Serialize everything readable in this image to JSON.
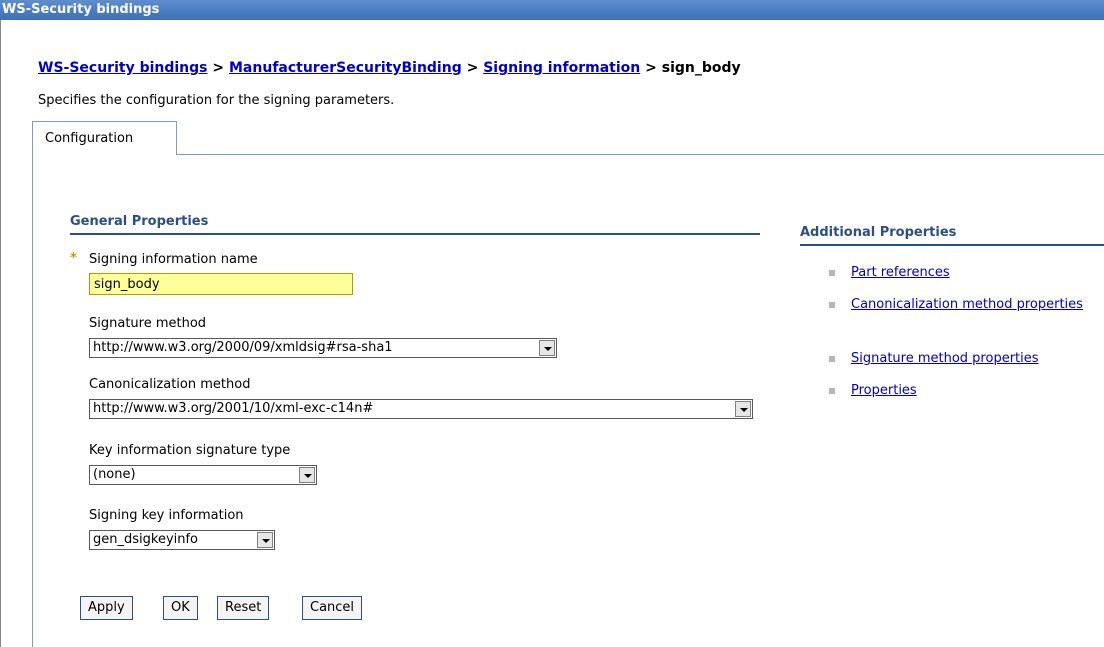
{
  "titlebar": {
    "title": "WS-Security bindings"
  },
  "breadcrumb": {
    "items": [
      "WS-Security bindings",
      "ManufacturerSecurityBinding",
      "Signing information"
    ],
    "current": "sign_body",
    "separator": ">"
  },
  "description": "Specifies the configuration for the signing parameters.",
  "tabs": [
    {
      "label": "Configuration"
    }
  ],
  "general": {
    "title": "General Properties",
    "required_marker": "*",
    "name_label": "Signing information name",
    "name_value": "sign_body",
    "sig_method_label": "Signature method",
    "sig_method_value": "http://www.w3.org/2000/09/xmldsig#rsa-sha1",
    "canon_label": "Canonicalization method",
    "canon_value": "http://www.w3.org/2001/10/xml-exc-c14n#",
    "keyinfo_sig_label": "Key information signature type",
    "keyinfo_sig_value": "(none)",
    "signing_key_label": "Signing key information",
    "signing_key_value": "gen_dsigkeyinfo"
  },
  "buttons": {
    "apply": "Apply",
    "ok": "OK",
    "reset": "Reset",
    "cancel": "Cancel"
  },
  "additional": {
    "title": "Additional Properties",
    "links": [
      {
        "label": "Part references"
      },
      {
        "label": "Canonicalization method properties"
      },
      {
        "label": "Signature method properties"
      },
      {
        "label": "Properties"
      }
    ]
  },
  "colors": {
    "titlebar": "#3c6fb8",
    "link": "#0000cc",
    "section": "#2b4f86",
    "required_field": "#ffff99"
  }
}
